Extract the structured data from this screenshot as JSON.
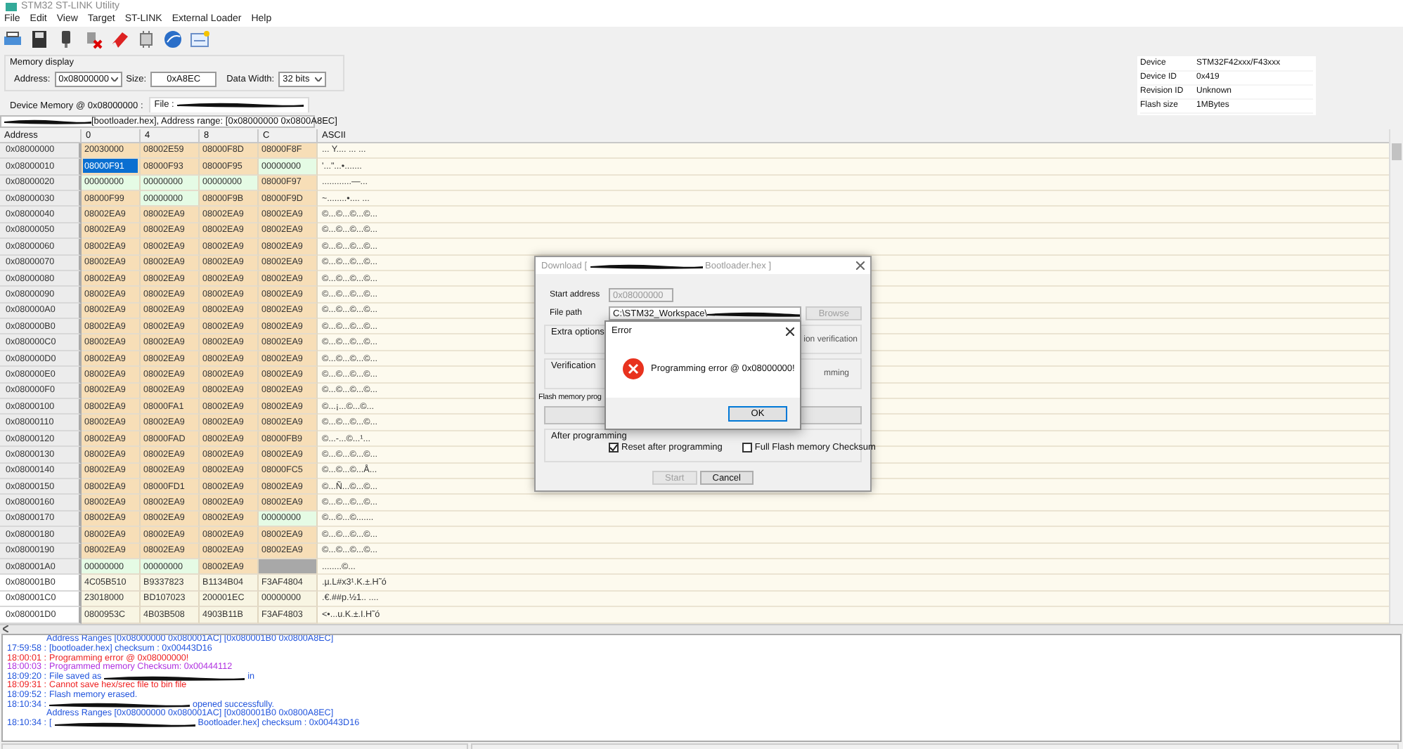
{
  "window": {
    "title": "STM32 ST-LINK Utility"
  },
  "menu": [
    "File",
    "Edit",
    "View",
    "Target",
    "ST-LINK",
    "External Loader",
    "Help"
  ],
  "memory_display": {
    "title": "Memory display",
    "address_label": "Address:",
    "address": "0x08000000",
    "size_label": "Size:",
    "size": "0xA8EC",
    "width_label": "Data Width:",
    "width": "32 bits"
  },
  "device_info": [
    {
      "label": "Device",
      "value": "STM32F42xxx/F43xxx"
    },
    {
      "label": "Device ID",
      "value": "0x419"
    },
    {
      "label": "Revision ID",
      "value": "Unknown"
    },
    {
      "label": "Flash size",
      "value": "1MBytes"
    }
  ],
  "tabs": [
    {
      "selected": false,
      "parts": [
        {
          "kind": "text",
          "text": "Device Memory @ 0x08000000 :"
        }
      ]
    },
    {
      "selected": true,
      "parts": [
        {
          "kind": "text",
          "text": "File :"
        },
        {
          "kind": "redaction"
        }
      ]
    }
  ],
  "file_info": [
    {
      "kind": "redaction"
    },
    {
      "kind": "text",
      "text": "[bootloader.hex], Address range: [0x08000000 0x0800A8EC]"
    }
  ],
  "table": {
    "address_header": "Address",
    "hex_columns": [
      "0",
      "4",
      "8",
      "C"
    ],
    "ascii_header": "ASCII",
    "rows": [
      {
        "address": "0x08000000",
        "ascii": "... Y.... ... ...",
        "cells": [
          {
            "value": "20030000",
            "kind": "code",
            "selected": false
          },
          {
            "value": "08002E59",
            "kind": "code",
            "selected": false
          },
          {
            "value": "08000F8D",
            "kind": "code",
            "selected": false
          },
          {
            "value": "08000F8F",
            "kind": "code",
            "selected": false
          }
        ]
      },
      {
        "address": "0x08000010",
        "ascii": "'...\"...•.......",
        "cells": [
          {
            "value": "08000F91",
            "kind": "code",
            "selected": true
          },
          {
            "value": "08000F93",
            "kind": "code",
            "selected": false
          },
          {
            "value": "08000F95",
            "kind": "code",
            "selected": false
          },
          {
            "value": "00000000",
            "kind": "blank",
            "selected": false
          }
        ]
      },
      {
        "address": "0x08000020",
        "ascii": "............—...",
        "cells": [
          {
            "value": "00000000",
            "kind": "blank",
            "selected": false
          },
          {
            "value": "00000000",
            "kind": "blank",
            "selected": false
          },
          {
            "value": "00000000",
            "kind": "blank",
            "selected": false
          },
          {
            "value": "08000F97",
            "kind": "code",
            "selected": false
          }
        ]
      },
      {
        "address": "0x08000030",
        "ascii": "~........•.... ...",
        "cells": [
          {
            "value": "08000F99",
            "kind": "code",
            "selected": false
          },
          {
            "value": "00000000",
            "kind": "blank",
            "selected": false
          },
          {
            "value": "08000F9B",
            "kind": "code",
            "selected": false
          },
          {
            "value": "08000F9D",
            "kind": "code",
            "selected": false
          }
        ]
      },
      {
        "address": "0x08000040",
        "ascii": "©...©...©...©...",
        "cells": [
          {
            "value": "08002EA9",
            "kind": "code",
            "selected": false
          },
          {
            "value": "08002EA9",
            "kind": "code",
            "selected": false
          },
          {
            "value": "08002EA9",
            "kind": "code",
            "selected": false
          },
          {
            "value": "08002EA9",
            "kind": "code",
            "selected": false
          }
        ]
      },
      {
        "address": "0x08000050",
        "ascii": "©...©...©...©...",
        "cells": [
          {
            "value": "08002EA9",
            "kind": "code",
            "selected": false
          },
          {
            "value": "08002EA9",
            "kind": "code",
            "selected": false
          },
          {
            "value": "08002EA9",
            "kind": "code",
            "selected": false
          },
          {
            "value": "08002EA9",
            "kind": "code",
            "selected": false
          }
        ]
      },
      {
        "address": "0x08000060",
        "ascii": "©...©...©...©...",
        "cells": [
          {
            "value": "08002EA9",
            "kind": "code",
            "selected": false
          },
          {
            "value": "08002EA9",
            "kind": "code",
            "selected": false
          },
          {
            "value": "08002EA9",
            "kind": "code",
            "selected": false
          },
          {
            "value": "08002EA9",
            "kind": "code",
            "selected": false
          }
        ]
      },
      {
        "address": "0x08000070",
        "ascii": "©...©...©...©...",
        "cells": [
          {
            "value": "08002EA9",
            "kind": "code",
            "selected": false
          },
          {
            "value": "08002EA9",
            "kind": "code",
            "selected": false
          },
          {
            "value": "08002EA9",
            "kind": "code",
            "selected": false
          },
          {
            "value": "08002EA9",
            "kind": "code",
            "selected": false
          }
        ]
      },
      {
        "address": "0x08000080",
        "ascii": "©...©...©...©...",
        "cells": [
          {
            "value": "08002EA9",
            "kind": "code",
            "selected": false
          },
          {
            "value": "08002EA9",
            "kind": "code",
            "selected": false
          },
          {
            "value": "08002EA9",
            "kind": "code",
            "selected": false
          },
          {
            "value": "08002EA9",
            "kind": "code",
            "selected": false
          }
        ]
      },
      {
        "address": "0x08000090",
        "ascii": "©...©...©...©...",
        "cells": [
          {
            "value": "08002EA9",
            "kind": "code",
            "selected": false
          },
          {
            "value": "08002EA9",
            "kind": "code",
            "selected": false
          },
          {
            "value": "08002EA9",
            "kind": "code",
            "selected": false
          },
          {
            "value": "08002EA9",
            "kind": "code",
            "selected": false
          }
        ]
      },
      {
        "address": "0x080000A0",
        "ascii": "©...©...©...©...",
        "cells": [
          {
            "value": "08002EA9",
            "kind": "code",
            "selected": false
          },
          {
            "value": "08002EA9",
            "kind": "code",
            "selected": false
          },
          {
            "value": "08002EA9",
            "kind": "code",
            "selected": false
          },
          {
            "value": "08002EA9",
            "kind": "code",
            "selected": false
          }
        ]
      },
      {
        "address": "0x080000B0",
        "ascii": "©...©...©...©...",
        "cells": [
          {
            "value": "08002EA9",
            "kind": "code",
            "selected": false
          },
          {
            "value": "08002EA9",
            "kind": "code",
            "selected": false
          },
          {
            "value": "08002EA9",
            "kind": "code",
            "selected": false
          },
          {
            "value": "08002EA9",
            "kind": "code",
            "selected": false
          }
        ]
      },
      {
        "address": "0x080000C0",
        "ascii": "©...©...©...©...",
        "cells": [
          {
            "value": "08002EA9",
            "kind": "code",
            "selected": false
          },
          {
            "value": "08002EA9",
            "kind": "code",
            "selected": false
          },
          {
            "value": "08002EA9",
            "kind": "code",
            "selected": false
          },
          {
            "value": "08002EA9",
            "kind": "code",
            "selected": false
          }
        ]
      },
      {
        "address": "0x080000D0",
        "ascii": "©...©...©...©...",
        "cells": [
          {
            "value": "08002EA9",
            "kind": "code",
            "selected": false
          },
          {
            "value": "08002EA9",
            "kind": "code",
            "selected": false
          },
          {
            "value": "08002EA9",
            "kind": "code",
            "selected": false
          },
          {
            "value": "08002EA9",
            "kind": "code",
            "selected": false
          }
        ]
      },
      {
        "address": "0x080000E0",
        "ascii": "©...©...©...©...",
        "cells": [
          {
            "value": "08002EA9",
            "kind": "code",
            "selected": false
          },
          {
            "value": "08002EA9",
            "kind": "code",
            "selected": false
          },
          {
            "value": "08002EA9",
            "kind": "code",
            "selected": false
          },
          {
            "value": "08002EA9",
            "kind": "code",
            "selected": false
          }
        ]
      },
      {
        "address": "0x080000F0",
        "ascii": "©...©...©...©...",
        "cells": [
          {
            "value": "08002EA9",
            "kind": "code",
            "selected": false
          },
          {
            "value": "08002EA9",
            "kind": "code",
            "selected": false
          },
          {
            "value": "08002EA9",
            "kind": "code",
            "selected": false
          },
          {
            "value": "08002EA9",
            "kind": "code",
            "selected": false
          }
        ]
      },
      {
        "address": "0x08000100",
        "ascii": "©...¡...©...©...",
        "cells": [
          {
            "value": "08002EA9",
            "kind": "code",
            "selected": false
          },
          {
            "value": "08000FA1",
            "kind": "code",
            "selected": false
          },
          {
            "value": "08002EA9",
            "kind": "code",
            "selected": false
          },
          {
            "value": "08002EA9",
            "kind": "code",
            "selected": false
          }
        ]
      },
      {
        "address": "0x08000110",
        "ascii": "©...©...©...©...",
        "cells": [
          {
            "value": "08002EA9",
            "kind": "code",
            "selected": false
          },
          {
            "value": "08002EA9",
            "kind": "code",
            "selected": false
          },
          {
            "value": "08002EA9",
            "kind": "code",
            "selected": false
          },
          {
            "value": "08002EA9",
            "kind": "code",
            "selected": false
          }
        ]
      },
      {
        "address": "0x08000120",
        "ascii": "©...-...©...¹...",
        "cells": [
          {
            "value": "08002EA9",
            "kind": "code",
            "selected": false
          },
          {
            "value": "08000FAD",
            "kind": "code",
            "selected": false
          },
          {
            "value": "08002EA9",
            "kind": "code",
            "selected": false
          },
          {
            "value": "08000FB9",
            "kind": "code",
            "selected": false
          }
        ]
      },
      {
        "address": "0x08000130",
        "ascii": "©...©...©...©...",
        "cells": [
          {
            "value": "08002EA9",
            "kind": "code",
            "selected": false
          },
          {
            "value": "08002EA9",
            "kind": "code",
            "selected": false
          },
          {
            "value": "08002EA9",
            "kind": "code",
            "selected": false
          },
          {
            "value": "08002EA9",
            "kind": "code",
            "selected": false
          }
        ]
      },
      {
        "address": "0x08000140",
        "ascii": "©...©...©...Å...",
        "cells": [
          {
            "value": "08002EA9",
            "kind": "code",
            "selected": false
          },
          {
            "value": "08002EA9",
            "kind": "code",
            "selected": false
          },
          {
            "value": "08002EA9",
            "kind": "code",
            "selected": false
          },
          {
            "value": "08000FC5",
            "kind": "code",
            "selected": false
          }
        ]
      },
      {
        "address": "0x08000150",
        "ascii": "©...Ñ...©...©...",
        "cells": [
          {
            "value": "08002EA9",
            "kind": "code",
            "selected": false
          },
          {
            "value": "08000FD1",
            "kind": "code",
            "selected": false
          },
          {
            "value": "08002EA9",
            "kind": "code",
            "selected": false
          },
          {
            "value": "08002EA9",
            "kind": "code",
            "selected": false
          }
        ]
      },
      {
        "address": "0x08000160",
        "ascii": "©...©...©...©...",
        "cells": [
          {
            "value": "08002EA9",
            "kind": "code",
            "selected": false
          },
          {
            "value": "08002EA9",
            "kind": "code",
            "selected": false
          },
          {
            "value": "08002EA9",
            "kind": "code",
            "selected": false
          },
          {
            "value": "08002EA9",
            "kind": "code",
            "selected": false
          }
        ]
      },
      {
        "address": "0x08000170",
        "ascii": "©...©...©.......",
        "cells": [
          {
            "value": "08002EA9",
            "kind": "code",
            "selected": false
          },
          {
            "value": "08002EA9",
            "kind": "code",
            "selected": false
          },
          {
            "value": "08002EA9",
            "kind": "code",
            "selected": false
          },
          {
            "value": "00000000",
            "kind": "blank",
            "selected": false
          }
        ]
      },
      {
        "address": "0x08000180",
        "ascii": "©...©...©...©...",
        "cells": [
          {
            "value": "08002EA9",
            "kind": "code",
            "selected": false
          },
          {
            "value": "08002EA9",
            "kind": "code",
            "selected": false
          },
          {
            "value": "08002EA9",
            "kind": "code",
            "selected": false
          },
          {
            "value": "08002EA9",
            "kind": "code",
            "selected": false
          }
        ]
      },
      {
        "address": "0x08000190",
        "ascii": "©...©...©...©...",
        "cells": [
          {
            "value": "08002EA9",
            "kind": "code",
            "selected": false
          },
          {
            "value": "08002EA9",
            "kind": "code",
            "selected": false
          },
          {
            "value": "08002EA9",
            "kind": "code",
            "selected": false
          },
          {
            "value": "08002EA9",
            "kind": "code",
            "selected": false
          }
        ]
      },
      {
        "address": "0x080001A0",
        "ascii": "........©...",
        "cells": [
          {
            "value": "00000000",
            "kind": "blank",
            "selected": false
          },
          {
            "value": "00000000",
            "kind": "blank",
            "selected": false
          },
          {
            "value": "08002EA9",
            "kind": "code",
            "selected": false
          },
          {
            "kind": "empty",
            "selected": false
          }
        ]
      },
      {
        "address": "0x080001B0",
        "ascii": ".µ.L#x3¹.K.±.H˜ó",
        "cells": [
          {
            "value": "4C05B510",
            "kind": "plain",
            "selected": false
          },
          {
            "value": "B9337823",
            "kind": "plain",
            "selected": false
          },
          {
            "value": "B1134B04",
            "kind": "plain",
            "selected": false
          },
          {
            "value": "F3AF4804",
            "kind": "plain",
            "selected": false
          }
        ]
      },
      {
        "address": "0x080001C0",
        "ascii": ".€.##p.½1.. ....",
        "cells": [
          {
            "value": "23018000",
            "kind": "plain",
            "selected": false
          },
          {
            "value": "BD107023",
            "kind": "plain",
            "selected": false
          },
          {
            "value": "200001EC",
            "kind": "plain",
            "selected": false
          },
          {
            "value": "00000000",
            "kind": "plain",
            "selected": false
          }
        ]
      },
      {
        "address": "0x080001D0",
        "ascii": "<•...u.K.±.I.H˜ó",
        "cells": [
          {
            "value": "0800953C",
            "kind": "plain",
            "selected": false
          },
          {
            "value": "4B03B508",
            "kind": "plain",
            "selected": false
          },
          {
            "value": "4903B11B",
            "kind": "plain",
            "selected": false
          },
          {
            "value": "F3AF4803",
            "kind": "plain",
            "selected": false
          }
        ]
      }
    ]
  },
  "log": [
    {
      "kind": "info",
      "parts": [
        {
          "kind": "text",
          "text": "Address Ranges [0x08000000 0x080001AC] [0x080001B0 0x0800A8EC]"
        }
      ]
    },
    {
      "kind": "info",
      "time": "17:59:58 :",
      "parts": [
        {
          "kind": "text",
          "text": "[bootloader.hex] checksum : 0x00443D16"
        }
      ]
    },
    {
      "kind": "error",
      "time": "18:00:01 :",
      "parts": [
        {
          "kind": "text",
          "text": "Programming error @ 0x08000000!"
        }
      ]
    },
    {
      "kind": "note",
      "time": "18:00:03 :",
      "parts": [
        {
          "kind": "text",
          "text": "Programmed memory Checksum: 0x00444112"
        }
      ]
    },
    {
      "kind": "info",
      "time": "18:09:20 :",
      "parts": [
        {
          "kind": "text",
          "text": "File saved as"
        },
        {
          "kind": "redaction"
        },
        {
          "kind": "text",
          "text": "in"
        }
      ]
    },
    {
      "kind": "error",
      "time": "18:09:31 :",
      "parts": [
        {
          "kind": "text",
          "text": "Cannot save hex/srec file to bin file"
        }
      ]
    },
    {
      "kind": "info",
      "time": "18:09:52 :",
      "parts": [
        {
          "kind": "text",
          "text": "Flash memory erased."
        }
      ]
    },
    {
      "kind": "info",
      "time": "18:10:34 :",
      "parts": [
        {
          "kind": "redaction"
        },
        {
          "kind": "text",
          "text": "opened successfully."
        }
      ]
    },
    {
      "kind": "info",
      "parts": [
        {
          "kind": "text",
          "text": "Address Ranges [0x08000000 0x080001AC] [0x080001B0 0x0800A8EC]"
        }
      ]
    },
    {
      "kind": "info",
      "time": "18:10:34 :",
      "parts": [
        {
          "kind": "text",
          "text": "["
        },
        {
          "kind": "redaction"
        },
        {
          "kind": "text",
          "text": "Bootloader.hex] checksum : 0x00443D16"
        }
      ]
    }
  ],
  "download_dialog": {
    "title": [
      {
        "kind": "text",
        "text": "Download ["
      },
      {
        "kind": "redaction"
      },
      {
        "kind": "text",
        "text": "Bootloader.hex ]"
      }
    ],
    "start_address_label": "Start address",
    "start_address": "0x08000000",
    "file_path_label": "File path",
    "file_path": [
      {
        "kind": "text",
        "text": "C:\\STM32_Workspace\\"
      },
      {
        "kind": "redaction"
      }
    ],
    "browse": "Browse",
    "extra_options_label": "Extra options",
    "extra_options_tail": "ion verification",
    "verification_label": "Verification",
    "verification_tail": "mming",
    "progress_label": "Flash memory prog",
    "progress": {
      "level": 0
    },
    "after_label": "After programming",
    "checkboxes": [
      {
        "label": "Reset after programming",
        "checked": true
      },
      {
        "label": "Full Flash memory Checksum",
        "checked": false
      }
    ],
    "start": "Start",
    "cancel": "Cancel"
  },
  "error_dialog": {
    "title": "Error",
    "message": "Programming error @ 0x08000000!",
    "button": "OK"
  }
}
